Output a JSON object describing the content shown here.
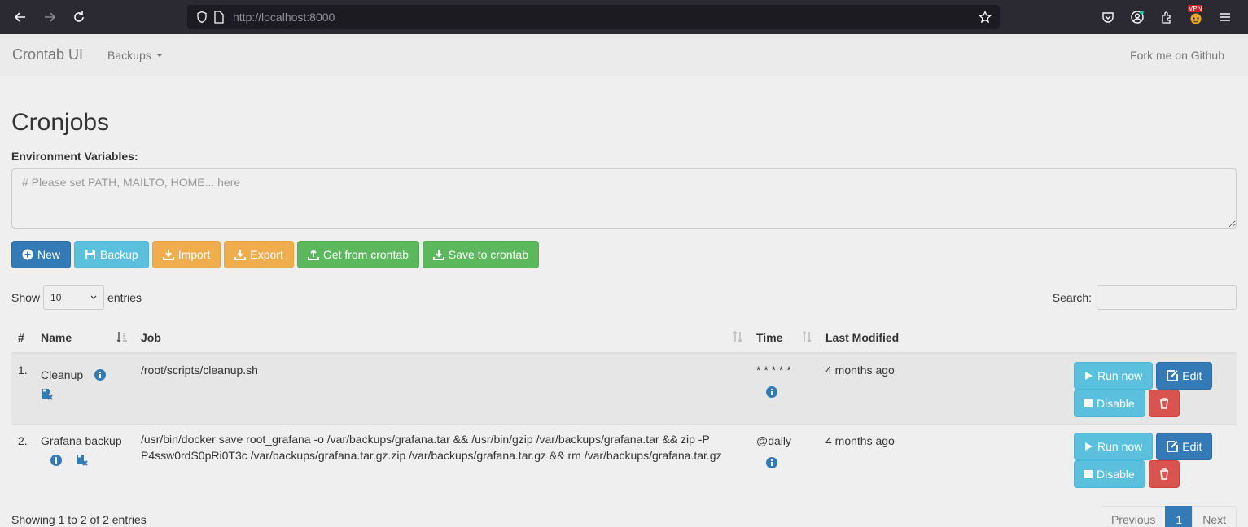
{
  "browser": {
    "url_main": "http://localhost",
    "url_port": ":8000"
  },
  "navbar": {
    "brand": "Crontab UI",
    "backups_label": "Backups",
    "fork_label": "Fork me on Github"
  },
  "page": {
    "title": "Cronjobs",
    "env_label": "Environment Variables:",
    "env_placeholder": "# Please set PATH, MAILTO, HOME... here"
  },
  "toolbar": {
    "new_label": "New",
    "backup_label": "Backup",
    "import_label": "Import",
    "export_label": "Export",
    "get_label": "Get from crontab",
    "save_label": "Save to crontab"
  },
  "datatable": {
    "show_label": "Show",
    "entries_label": "entries",
    "length_value": "10",
    "search_label": "Search:",
    "columns": {
      "num": "#",
      "name": "Name",
      "job": "Job",
      "time": "Time",
      "modified": "Last Modified"
    },
    "rows": [
      {
        "num": "1.",
        "name": "Cleanup",
        "job": "/root/scripts/cleanup.sh",
        "time": "* * * * *",
        "modified": "4 months ago",
        "run_label": "Run now",
        "edit_label": "Edit",
        "disable_label": "Disable"
      },
      {
        "num": "2.",
        "name": "Grafana backup",
        "job": "/usr/bin/docker save root_grafana -o /var/backups/grafana.tar && /usr/bin/gzip /var/backups/grafana.tar && zip -P P4ssw0rdS0pRi0T3c /var/backups/grafana.tar.gz.zip /var/backups/grafana.tar.gz && rm /var/backups/grafana.tar.gz",
        "time": "@daily",
        "modified": "4 months ago",
        "run_label": "Run now",
        "edit_label": "Edit",
        "disable_label": "Disable"
      }
    ],
    "info": "Showing 1 to 2 of 2 entries",
    "pagination": {
      "previous": "Previous",
      "current": "1",
      "next": "Next"
    }
  },
  "colors": {
    "primary": "#337ab7",
    "info": "#5bc0de",
    "warning": "#f0ad4e",
    "success": "#5cb85c",
    "danger": "#d9534f"
  }
}
